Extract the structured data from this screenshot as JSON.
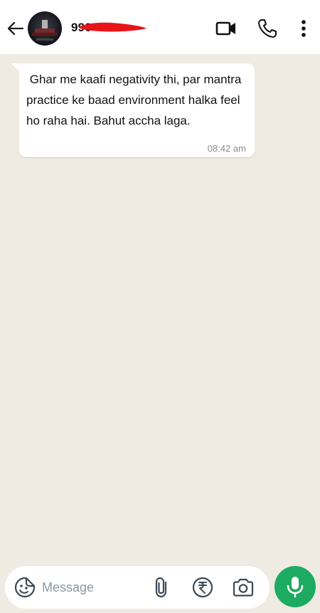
{
  "header": {
    "contact_name": "990",
    "icons": {
      "back": "arrow-left-icon",
      "video": "video-camera-icon",
      "call": "phone-icon",
      "menu": "more-vertical-icon"
    }
  },
  "messages": [
    {
      "text": " Ghar me kaafi negativity thi, par mantra practice ke baad environment halka feel ho raha hai. Bahut accha laga.",
      "time": "08:42 am",
      "direction": "incoming"
    }
  ],
  "composer": {
    "placeholder": "Message",
    "icons": {
      "emoji": "sticker-smiley-icon",
      "attach": "paperclip-icon",
      "payment": "rupee-icon",
      "camera": "camera-icon",
      "mic": "microphone-icon"
    }
  },
  "colors": {
    "chat_background": "#efeae2",
    "bubble": "#ffffff",
    "accent_green": "#1daa61",
    "redaction": "#e8141a"
  }
}
